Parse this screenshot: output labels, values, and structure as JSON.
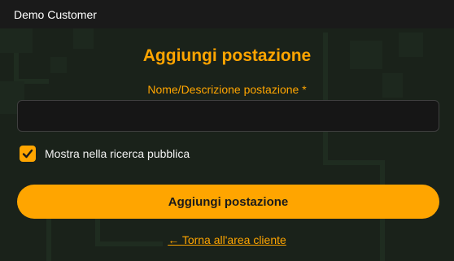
{
  "header": {
    "customer_name": "Demo Customer"
  },
  "form": {
    "title": "Aggiungi postazione",
    "field_label": "Nome/Descrizione postazione *",
    "field_value": "",
    "checkbox_label": "Mostra nella ricerca pubblica",
    "checkbox_checked": true,
    "submit_label": "Aggiungi postazione",
    "back_link": "← Torna all'area cliente"
  },
  "colors": {
    "accent": "#ffa500",
    "topbar": "#1a1a1a",
    "input_bg": "#161616"
  },
  "icons": {
    "checkbox": "check-icon"
  }
}
